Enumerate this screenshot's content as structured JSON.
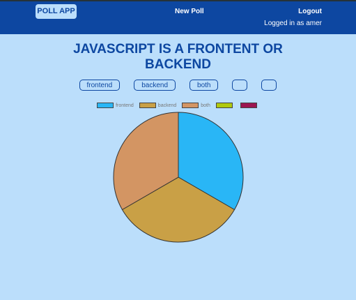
{
  "header": {
    "logo": "POLL APP",
    "new_poll": "New Poll",
    "logout": "Logout",
    "logged_in": "Logged in as amer"
  },
  "poll": {
    "question": "JAVASCRIPT IS A FRONTENT OR BACKEND",
    "options": [
      "frontend",
      "backend",
      "both",
      "",
      ""
    ]
  },
  "chart_data": {
    "type": "pie",
    "categories": [
      "frontend",
      "backend",
      "both",
      "",
      ""
    ],
    "values": [
      1,
      1,
      1,
      0,
      0
    ],
    "colors": [
      "#29b6f6",
      "#c9a046",
      "#d39563",
      "#b0c90e",
      "#9c1650"
    ],
    "legend": "top"
  }
}
